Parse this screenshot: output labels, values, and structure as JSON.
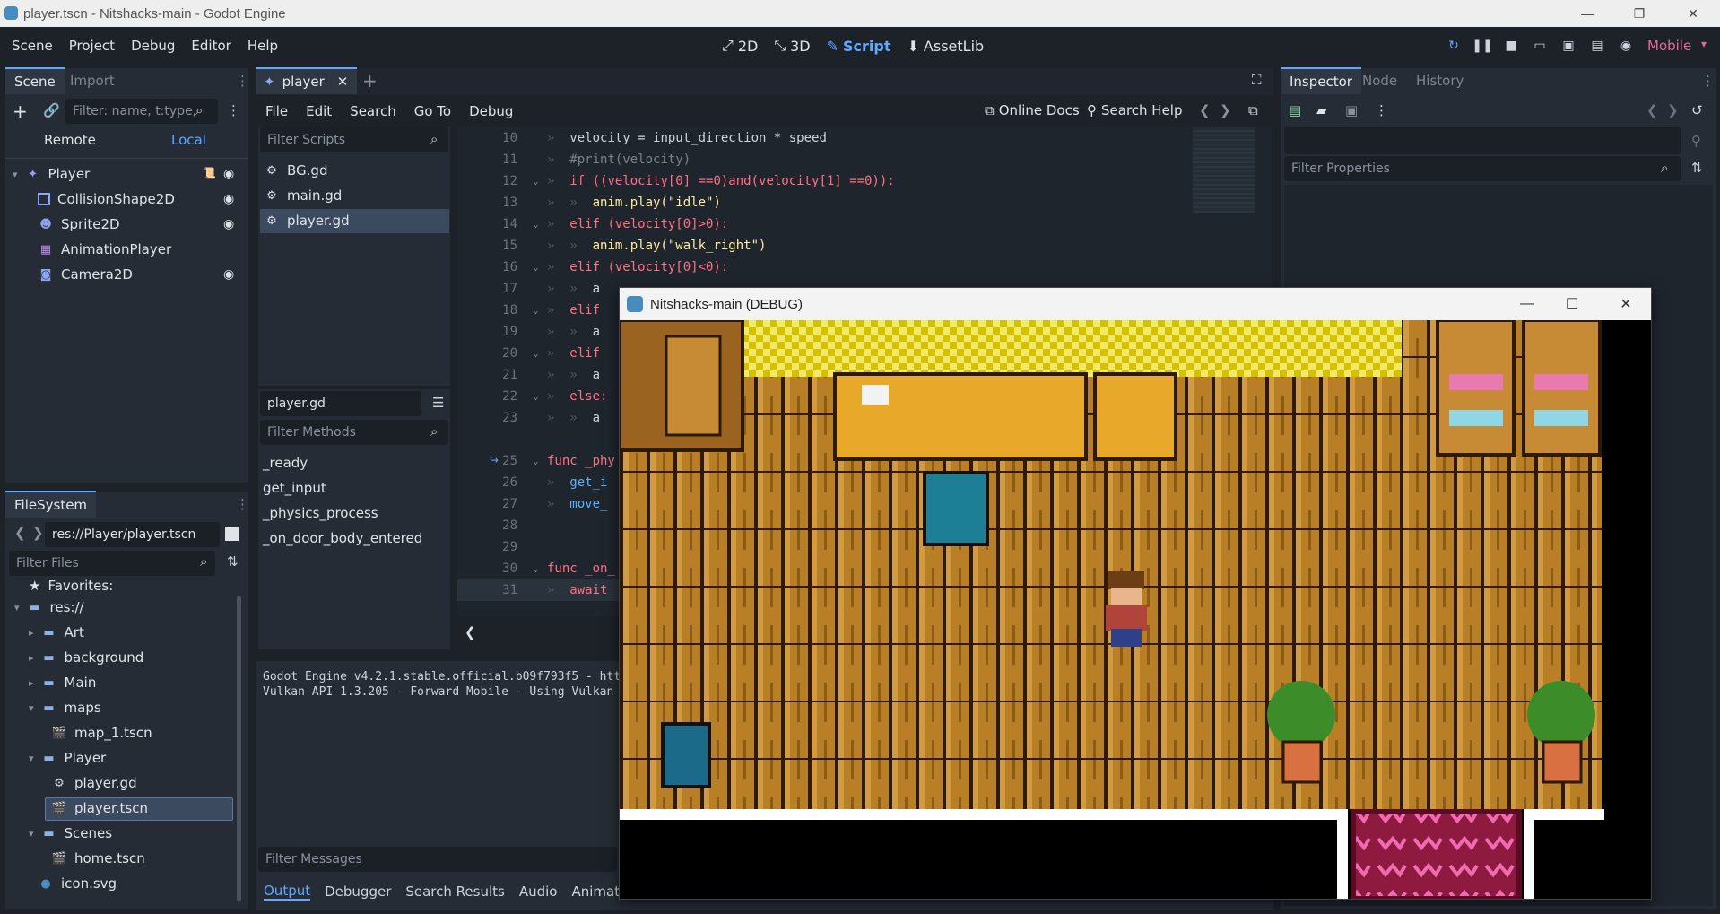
{
  "window": {
    "title": "player.tscn - Nitshacks-main - Godot Engine"
  },
  "menu": [
    "Scene",
    "Project",
    "Debug",
    "Editor",
    "Help"
  ],
  "workspaces": [
    {
      "label": "2D",
      "icon": "2d-icon"
    },
    {
      "label": "3D",
      "icon": "3d-icon"
    },
    {
      "label": "Script",
      "icon": "script-icon",
      "active": true
    },
    {
      "label": "AssetLib",
      "icon": "assetlib-icon"
    }
  ],
  "renderer": "Mobile",
  "scene_dock": {
    "tabs": [
      "Scene",
      "Import"
    ],
    "filter_placeholder": "Filter: name, t:type,",
    "remote": "Remote",
    "local": "Local",
    "nodes": [
      {
        "name": "Player",
        "icon": "character-body-icon"
      },
      {
        "name": "CollisionShape2D",
        "icon": "collision-shape-icon"
      },
      {
        "name": "Sprite2D",
        "icon": "sprite-icon"
      },
      {
        "name": "AnimationPlayer",
        "icon": "animation-player-icon"
      },
      {
        "name": "Camera2D",
        "icon": "camera-icon"
      }
    ]
  },
  "filesystem": {
    "tab": "FileSystem",
    "path": "res://Player/player.tscn",
    "filter_placeholder": "Filter Files",
    "favorites": "Favorites:",
    "items": [
      {
        "label": "res://"
      },
      {
        "label": "Art"
      },
      {
        "label": "background"
      },
      {
        "label": "Main"
      },
      {
        "label": "maps"
      },
      {
        "label": "map_1.tscn"
      },
      {
        "label": "Player"
      },
      {
        "label": "player.gd"
      },
      {
        "label": "player.tscn"
      },
      {
        "label": "Scenes"
      },
      {
        "label": "home.tscn"
      },
      {
        "label": "icon.svg"
      }
    ]
  },
  "script_editor": {
    "scene_tab": "player",
    "menu": [
      "File",
      "Edit",
      "Search",
      "Go To",
      "Debug"
    ],
    "online_docs": "Online Docs",
    "search_help": "Search Help",
    "filter_scripts": "Filter Scripts",
    "scripts": [
      "BG.gd",
      "main.gd",
      "player.gd"
    ],
    "current_script": "player.gd",
    "filter_methods": "Filter Methods",
    "methods": [
      "_ready",
      "get_input",
      "_physics_process",
      "_on_door_body_entered"
    ],
    "lines": [
      {
        "n": "10",
        "code": "velocity = input_direction * speed"
      },
      {
        "n": "11",
        "code": "#print(velocity)"
      },
      {
        "n": "12",
        "code": "if ((velocity[0] ==0)and(velocity[1] ==0)):"
      },
      {
        "n": "13",
        "code": "anim.play(\"idle\")"
      },
      {
        "n": "14",
        "code": "elif (velocity[0]>0):"
      },
      {
        "n": "15",
        "code": "anim.play(\"walk_right\")"
      },
      {
        "n": "16",
        "code": "elif (velocity[0]<0):"
      },
      {
        "n": "17",
        "code": "a"
      },
      {
        "n": "18",
        "code": "elif"
      },
      {
        "n": "19",
        "code": "a"
      },
      {
        "n": "20",
        "code": "elif"
      },
      {
        "n": "21",
        "code": "a"
      },
      {
        "n": "22",
        "code": "else:"
      },
      {
        "n": "23",
        "code": "a"
      },
      {
        "n": "25",
        "code": "func _phy"
      },
      {
        "n": "26",
        "code": "get_i"
      },
      {
        "n": "27",
        "code": "move_"
      },
      {
        "n": "28",
        "code": ""
      },
      {
        "n": "29",
        "code": ""
      },
      {
        "n": "30",
        "code": "func _on_"
      },
      {
        "n": "31",
        "code": "await"
      }
    ]
  },
  "output": {
    "lines": [
      "Godot Engine v4.2.1.stable.official.b09f793f5 - htt",
      "Vulkan API 1.3.205 - Forward Mobile - Using Vulkan"
    ],
    "filter_messages": "Filter Messages",
    "tabs": [
      "Output",
      "Debugger",
      "Search Results",
      "Audio",
      "Animation"
    ]
  },
  "inspector": {
    "tabs": [
      "Inspector",
      "Node",
      "History"
    ],
    "filter_placeholder": "Filter Properties"
  },
  "game_window": {
    "title": "Nitshacks-main (DEBUG)"
  }
}
